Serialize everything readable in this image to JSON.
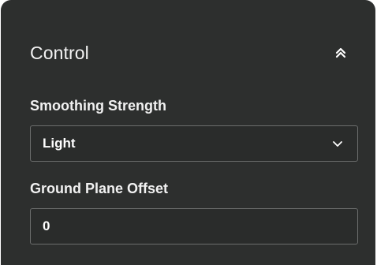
{
  "panel": {
    "title": "Control",
    "collapse_icon": "double-chevron-up-icon"
  },
  "smoothing": {
    "label": "Smoothing Strength",
    "selected": "Light",
    "dropdown_icon": "chevron-down-icon"
  },
  "ground_plane": {
    "label": "Ground Plane Offset",
    "value": "0"
  },
  "colors": {
    "panel_bg": "#2d2f2e",
    "field_border": "#6b6d6c",
    "text": "#ffffff"
  }
}
